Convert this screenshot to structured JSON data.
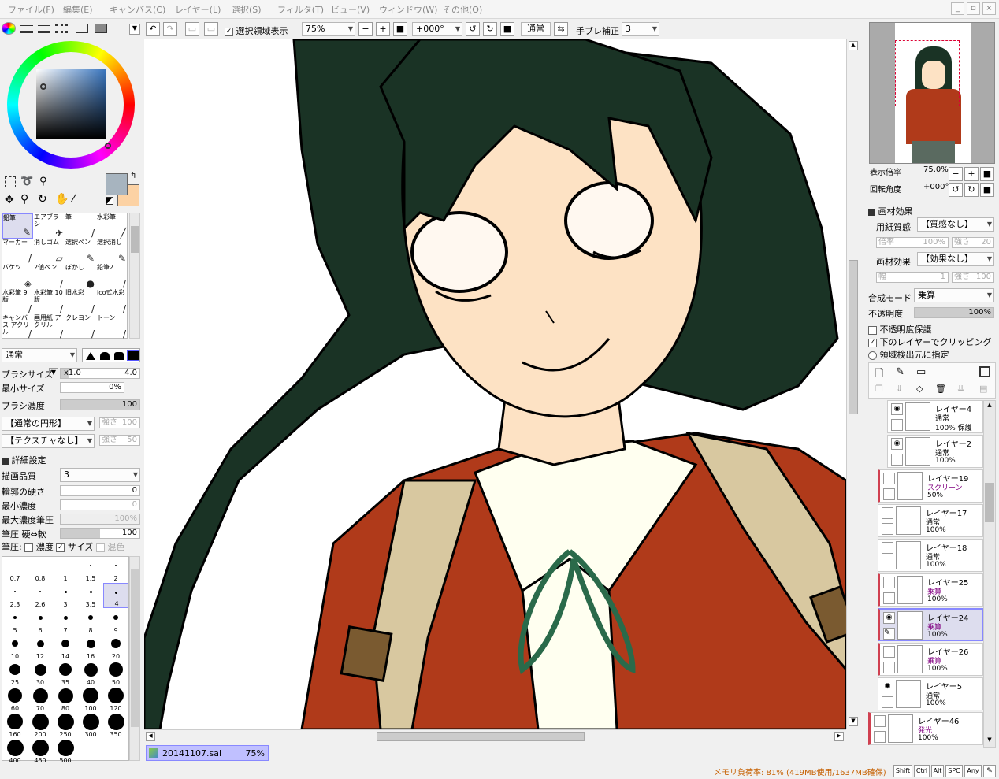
{
  "menu": [
    "ファイル(F)",
    "編集(E)",
    "キャンバス(C)",
    "レイヤー(L)",
    "選択(S)",
    "フィルタ(T)",
    "ビュー(V)",
    "ウィンドウ(W)",
    "その他(O)"
  ],
  "toolbar": {
    "selection_label": "選択領域表示",
    "zoom": "75%",
    "rotation": "+000°",
    "blend": "通常",
    "stabilizer_label": "手ブレ補正",
    "stabilizer_value": "3"
  },
  "tools": [
    {
      "label": "鉛筆",
      "icon": "✎"
    },
    {
      "label": "エアブラシ",
      "icon": "✈"
    },
    {
      "label": "筆",
      "icon": "/"
    },
    {
      "label": "水彩筆",
      "icon": "╱"
    },
    {
      "label": "マーカー",
      "icon": "/"
    },
    {
      "label": "消しゴム",
      "icon": "▱"
    },
    {
      "label": "選択ペン",
      "icon": "✎"
    },
    {
      "label": "選択消し",
      "icon": "✎"
    },
    {
      "label": "バケツ",
      "icon": "◈"
    },
    {
      "label": "2値ペン",
      "icon": "/"
    },
    {
      "label": "ぼかし",
      "icon": "●"
    },
    {
      "label": "鉛筆2",
      "icon": "/"
    },
    {
      "label": "水彩筆 9版",
      "icon": "/"
    },
    {
      "label": "水彩筆 10版",
      "icon": "/"
    },
    {
      "label": "旧水彩",
      "icon": "/"
    },
    {
      "label": "ico式水彩",
      "icon": "/"
    },
    {
      "label": "キャンバス アクリル",
      "icon": "/"
    },
    {
      "label": "画用紙 アクリル",
      "icon": "/"
    },
    {
      "label": "クレヨン",
      "icon": "/"
    },
    {
      "label": "トーン",
      "icon": "/"
    }
  ],
  "brush": {
    "mode": "通常",
    "size_label": "ブラシサイズ",
    "size_mult": "x1.0",
    "size_value": "4.0",
    "min_size_label": "最小サイズ",
    "min_size_value": "0%",
    "density_label": "ブラシ濃度",
    "density_value": "100",
    "shape": "【通常の円形】",
    "shape_strength": "強さ",
    "shape_strength_value": "100",
    "texture": "【テクスチャなし】",
    "texture_strength": "強さ",
    "texture_strength_value": "50",
    "detail_label": "詳細設定",
    "quality_label": "描画品質",
    "quality_value": "3",
    "edge_label": "輪郭の硬さ",
    "edge_value": "0",
    "min_density_label": "最小濃度",
    "min_density_value": "0",
    "max_pressure_label": "最大濃度筆圧",
    "max_pressure_value": "100%",
    "pressure_label": "筆圧 硬⇔軟",
    "pressure_value": "100",
    "pen_label": "筆圧:",
    "pen_density": "濃度",
    "pen_size": "サイズ",
    "pen_blend": "混色"
  },
  "brush_sizes": [
    {
      "v": "0.7",
      "d": 1
    },
    {
      "v": "0.8",
      "d": 1
    },
    {
      "v": "1",
      "d": 1
    },
    {
      "v": "1.5",
      "d": 2
    },
    {
      "v": "2",
      "d": 2
    },
    {
      "v": "2.3",
      "d": 2
    },
    {
      "v": "2.6",
      "d": 2
    },
    {
      "v": "3",
      "d": 3
    },
    {
      "v": "3.5",
      "d": 3
    },
    {
      "v": "4",
      "d": 3
    },
    {
      "v": "5",
      "d": 4
    },
    {
      "v": "6",
      "d": 5
    },
    {
      "v": "7",
      "d": 5
    },
    {
      "v": "8",
      "d": 6
    },
    {
      "v": "9",
      "d": 6
    },
    {
      "v": "10",
      "d": 8
    },
    {
      "v": "12",
      "d": 9
    },
    {
      "v": "14",
      "d": 10
    },
    {
      "v": "16",
      "d": 11
    },
    {
      "v": "20",
      "d": 12
    },
    {
      "v": "25",
      "d": 14
    },
    {
      "v": "30",
      "d": 15
    },
    {
      "v": "35",
      "d": 16
    },
    {
      "v": "40",
      "d": 17
    },
    {
      "v": "50",
      "d": 18
    },
    {
      "v": "60",
      "d": 18
    },
    {
      "v": "70",
      "d": 19
    },
    {
      "v": "80",
      "d": 19
    },
    {
      "v": "100",
      "d": 20
    },
    {
      "v": "120",
      "d": 20
    },
    {
      "v": "160",
      "d": 20
    },
    {
      "v": "200",
      "d": 21
    },
    {
      "v": "250",
      "d": 21
    },
    {
      "v": "300",
      "d": 21
    },
    {
      "v": "350",
      "d": 21
    },
    {
      "v": "400",
      "d": 21
    },
    {
      "v": "450",
      "d": 21
    },
    {
      "v": "500",
      "d": 21
    }
  ],
  "colors": {
    "primary": "#a7b4bf",
    "secondary": "#fcd2a4"
  },
  "navigator": {
    "zoom_label": "表示倍率",
    "zoom": "75.0%",
    "rotation_label": "回転角度",
    "rotation": "+000°"
  },
  "effects": {
    "title": "画材効果",
    "paper_label": "用紙質感",
    "paper_value": "【質感なし】",
    "paper_scale": "倍率",
    "paper_scale_value": "100%",
    "paper_strength": "強さ",
    "paper_strength_value": "20",
    "effect_label": "画材効果",
    "effect_value": "【効果なし】",
    "effect_width": "幅",
    "effect_width_value": "1",
    "effect_strength": "強さ",
    "effect_strength_value": "100"
  },
  "layer_props": {
    "blend_label": "合成モード",
    "blend_value": "乗算",
    "opacity_label": "不透明度",
    "opacity_value": "100%",
    "protect_label": "不透明度保護",
    "clip_label": "下のレイヤーでクリッピング",
    "select_label": "領域検出元に指定"
  },
  "layers": [
    {
      "name": "レイヤー4",
      "mode": "通常",
      "opacity": "100% 保護",
      "visible": true,
      "indent": 1,
      "mode_color": "#000"
    },
    {
      "name": "レイヤー2",
      "mode": "通常",
      "opacity": "100%",
      "visible": true,
      "indent": 1,
      "mode_color": "#000"
    },
    {
      "name": "レイヤー19",
      "mode": "スクリーン",
      "opacity": "50%",
      "visible": false,
      "indent": 0,
      "mode_color": "#800080"
    },
    {
      "name": "レイヤー17",
      "mode": "通常",
      "opacity": "100%",
      "visible": false,
      "indent": 0,
      "mode_color": "#000"
    },
    {
      "name": "レイヤー18",
      "mode": "通常",
      "opacity": "100%",
      "visible": false,
      "indent": 0,
      "mode_color": "#000"
    },
    {
      "name": "レイヤー25",
      "mode": "乗算",
      "opacity": "100%",
      "visible": false,
      "indent": 0,
      "mode_color": "#800080"
    },
    {
      "name": "レイヤー24",
      "mode": "乗算",
      "opacity": "100%",
      "visible": true,
      "indent": 0,
      "mode_color": "#800080",
      "selected": true
    },
    {
      "name": "レイヤー26",
      "mode": "乗算",
      "opacity": "100%",
      "visible": false,
      "indent": 0,
      "mode_color": "#800080"
    },
    {
      "name": "レイヤー5",
      "mode": "通常",
      "opacity": "100%",
      "visible": true,
      "indent": 0,
      "mode_color": "#000"
    },
    {
      "name": "レイヤー46",
      "mode": "発光",
      "opacity": "100%",
      "visible": false,
      "indent": -1,
      "mode_color": "#800080"
    }
  ],
  "document_tab": {
    "name": "20141107.sai",
    "zoom": "75%"
  },
  "status": {
    "memory": "メモリ負荷率: 81% (419MB使用/1637MB確保)",
    "keys": [
      "Shift",
      "Ctrl",
      "Alt",
      "SPC",
      "Any"
    ]
  }
}
